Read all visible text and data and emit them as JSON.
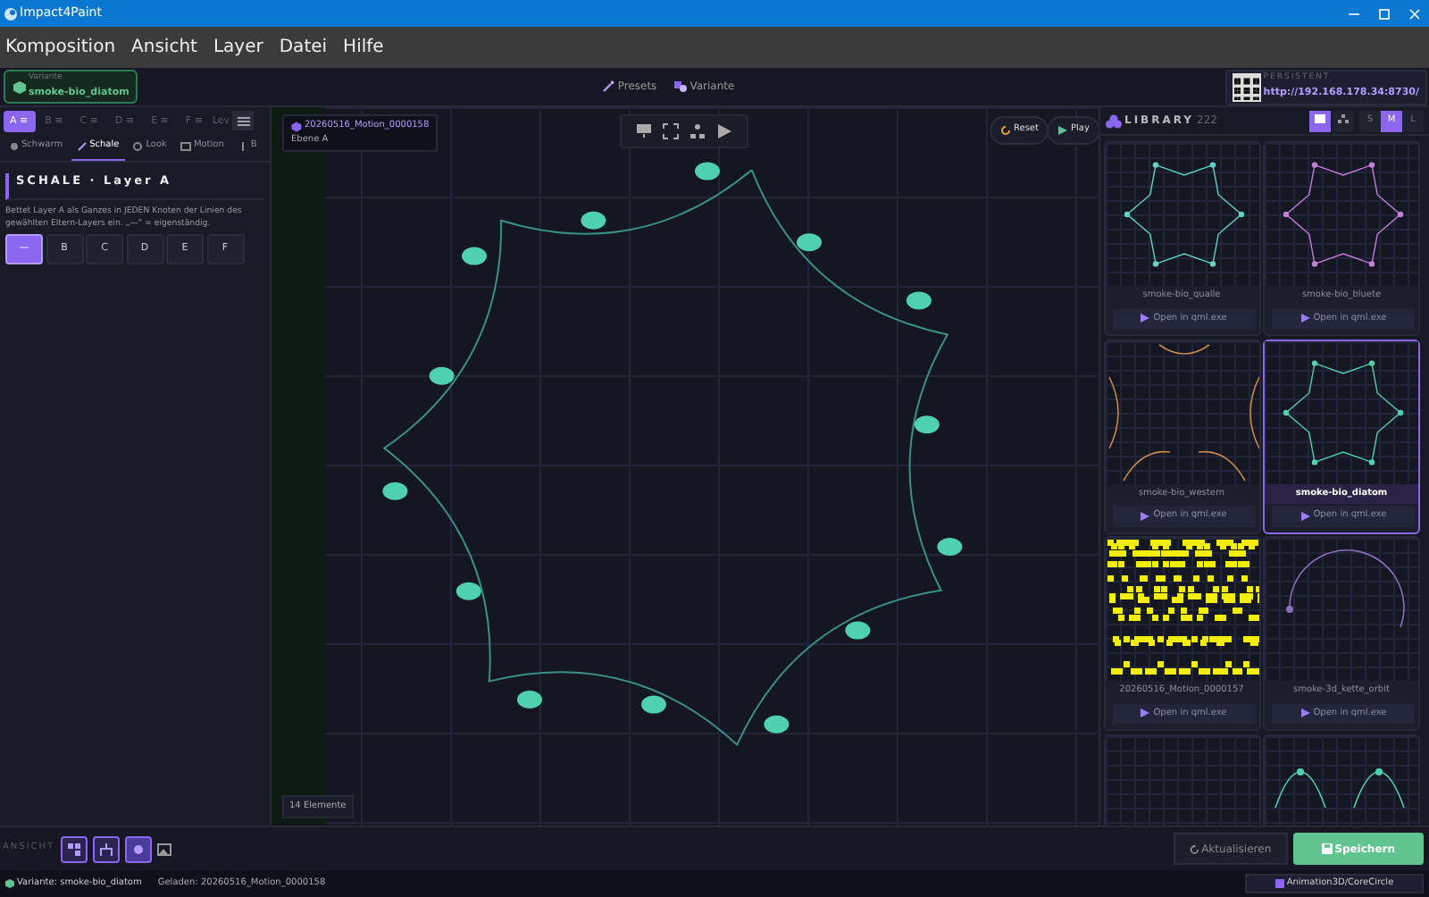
{
  "window": {
    "title": "Impact4Paint"
  },
  "menu": [
    "Komposition",
    "Ansicht",
    "Layer",
    "Datei",
    "Hilfe"
  ],
  "header": {
    "variant_label": "Variante",
    "variant_name": "smoke-bio_diatom",
    "presets": "Presets",
    "variante": "Variante",
    "persistent_label": "PERSISTENT",
    "url": "http://192.168.178.34:8730/"
  },
  "layers": [
    {
      "label": "A ≡",
      "selected": true
    },
    {
      "label": "B ≡",
      "selected": false
    },
    {
      "label": "C ≡",
      "selected": false
    },
    {
      "label": "D ≡",
      "selected": false
    },
    {
      "label": "E ≡",
      "selected": false
    },
    {
      "label": "F ≡",
      "selected": false
    }
  ],
  "layer_more": "Lev",
  "tabs": [
    {
      "label": "Schwarm",
      "selected": false
    },
    {
      "label": "Schale",
      "selected": true
    },
    {
      "label": "Look",
      "selected": false
    },
    {
      "label": "Motion",
      "selected": false
    },
    {
      "label": "B",
      "selected": false
    }
  ],
  "section": {
    "title": "SCHALE · Layer A",
    "description": "Bettet Layer A als Ganzes in JEDEN Knoten der Linien des gewählten Eltern-Layers ein. „—“ = eigenständig.",
    "options": [
      {
        "label": "—",
        "selected": true
      },
      {
        "label": "B",
        "selected": false
      },
      {
        "label": "C",
        "selected": false
      },
      {
        "label": "D",
        "selected": false
      },
      {
        "label": "E",
        "selected": false
      },
      {
        "label": "F",
        "selected": false
      }
    ]
  },
  "canvas": {
    "title": "20260516_Motion_0000158",
    "subtitle": "Ebene A",
    "reset": "Reset",
    "play": "Play",
    "count": "14 Elemente"
  },
  "library": {
    "title": "LIBRARY",
    "count": "222",
    "sizes": [
      {
        "label": "S",
        "selected": false
      },
      {
        "label": "M",
        "selected": true
      },
      {
        "label": "L",
        "selected": false
      }
    ],
    "cards": [
      {
        "kind": "star",
        "name": "smoke-bio_qualle",
        "action": "Open in qml.exe",
        "selected": false
      },
      {
        "kind": "star",
        "name": "smoke-bio_bluete",
        "action": "Open in qml.exe",
        "selected": false
      },
      {
        "kind": "corners",
        "name": "smoke-bio_western",
        "action": "Open in qml.exe",
        "selected": false
      },
      {
        "kind": "star",
        "name": "smoke-bio_diatom",
        "action": "Open in qml.exe",
        "selected": true
      },
      {
        "kind": "dots",
        "name": "20260516_Motion_0000157",
        "action": "Open in qml.exe",
        "selected": false
      },
      {
        "kind": "arc",
        "name": "smoke-3d_kette_orbit",
        "action": "Open in qml.exe",
        "selected": false
      },
      {
        "kind": "grid",
        "selected": false
      },
      {
        "kind": "wave",
        "selected": false
      }
    ]
  },
  "footer": {
    "label": "ANSICHT",
    "view_buttons": [
      {
        "selected": false
      },
      {
        "selected": false
      },
      {
        "selected": true
      }
    ],
    "refresh": "Aktualisieren",
    "save": "Speichern"
  },
  "status_bar": {
    "variant": "Variante: smoke-bio_diatom",
    "loaded": "Geladen: 20260516_Motion_0000158",
    "path": "Animation3D/CoreCircle"
  }
}
